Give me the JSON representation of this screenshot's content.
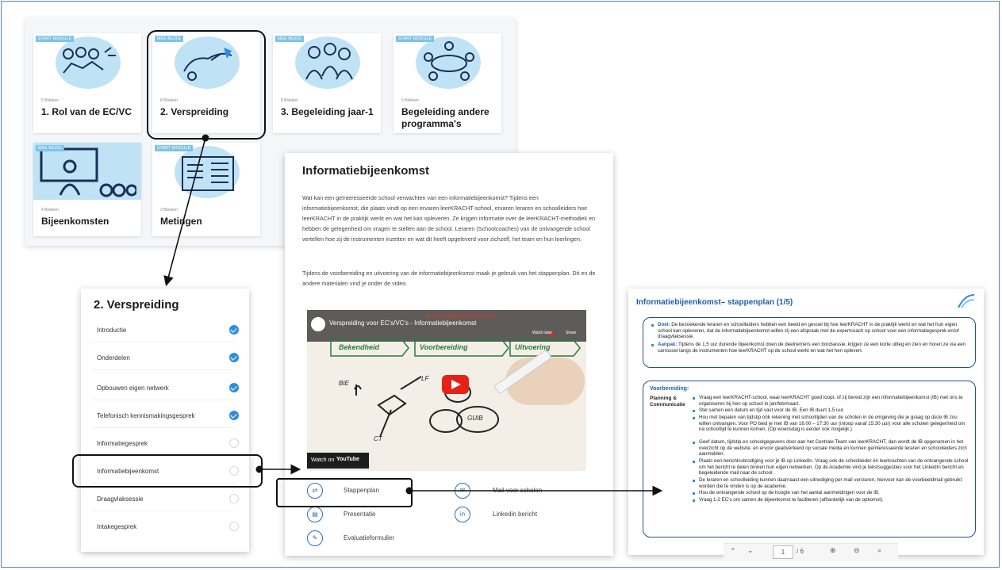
{
  "modules": {
    "cards": [
      {
        "badge": "START MODULE",
        "count": "5 Blokken",
        "title": "1. Rol van de EC/VC"
      },
      {
        "badge": "MEE BEZIG",
        "count": "8 Blokken",
        "title": "2. Verspreiding"
      },
      {
        "badge": "MEE BEZIG",
        "count": "8 Blokken",
        "title": "3. Begeleiding jaar-1"
      },
      {
        "badge": "START MODULE",
        "count": "6 Blokken",
        "title": "Begeleiding andere programma's"
      },
      {
        "badge": "MEE BEZIG",
        "count": "4 Blokken",
        "title": "Bijeenkomsten"
      },
      {
        "badge": "START MODULE",
        "count": "3 Blokken",
        "title": "Metingen"
      }
    ]
  },
  "sidebar": {
    "title": "2. Verspreiding",
    "items": [
      {
        "label": "Introductie",
        "done": true
      },
      {
        "label": "Onderdelen",
        "done": true
      },
      {
        "label": "Opbouwen eigen netwerk",
        "done": true
      },
      {
        "label": "Telefonisch kennismakingsgesprek",
        "done": true
      },
      {
        "label": "Informatiegesprek",
        "done": false
      },
      {
        "label": "Informatiebijeenkomst",
        "done": false
      },
      {
        "label": "Draagvlaksessie",
        "done": false
      },
      {
        "label": "Intakegesprek",
        "done": false
      }
    ]
  },
  "info": {
    "title": "Informatiebijeenkomst",
    "para1": "Wat kan een geïnteresseerde school verwachten van een informatiebijeenkomst? Tijdens een informatiebijeenkomst, die plaats vindt op een ervaren leerKRACHT-school, ervaren leraren en schoolleiders hoe leerKRACHT in de praktijk werkt en wat het kan opleveren. Ze krijgen informatie over de leerKRACHT-methodiek en hebben de gelegenheid om vragen te stellen aan de school. Leraren (Schoolcoaches) van de ontvangende school vertellen hoe zij de instrumenten inzetten en wat dit heeft opgeleverd voor zichzelf, het team en hun leerlingen.",
    "para2": "Tijdens de voorbereiding en uitvoering van de informatiebijeenkomst maak je gebruik van het stappenplan. Dit en de andere materialen vind je onder de video.",
    "video": {
      "title": "Verspreiding voor EC's/VC's - Informatiebijeenkomst",
      "watch_later": "Watch later",
      "share": "Share",
      "watch_on": "Watch on",
      "youtube": "YouTube",
      "board_heading": "Informatiebijeenkomst",
      "board_steps": [
        "Bekendheid",
        "Voorbereiding",
        "Uitvoering"
      ],
      "board_words": [
        "GUIB",
        "LF",
        "BIE",
        "CT"
      ]
    },
    "materials": [
      {
        "label": "Stappenplan",
        "icon": "arrows-icon"
      },
      {
        "label": "Mail voor scholen",
        "icon": "mail-icon"
      },
      {
        "label": "Presentatie",
        "icon": "document-icon"
      },
      {
        "label": "Linkedin bericht",
        "icon": "linkedin-icon"
      },
      {
        "label": "Evaluatieformulier",
        "icon": "pencil-icon"
      }
    ]
  },
  "plan": {
    "title": "Informatiebijeenkomst– stappenplan (1/5)",
    "doel_label": "Doel:",
    "doel_text": "De bezoekende leraren en schoolleiders hebben een beeld en gevoel bij hoe leerKRACHT in de praktijk werkt en wat het hun eigen school kan opleveren, dat de informatiebijeenkomst willen zij een afspraak met de expertcoach op school voor een informatiegesprek en/of draagvlaksessie.",
    "aanpak_label": "Aanpak:",
    "aanpak_text": "Tijdens de 1,5 uur durende bijeenkomst doen de deelnemers een bordsessie, krijgen ze een korte uitleg en zien en horen ze via een carrousel langs de instrumenten hoe leerKRACHT op de school werkt en wat het hen oplevert.",
    "prep_heading": "Voorbereiding:",
    "prep_label": "Planning & Communicatie",
    "bullets": [
      "Vraag een leerKRACHT-school, waar leerKRACHT goed loopt, of zij bereid zijn een informatiebijeenkomst (IB) met ons te organiseren bij hen op school in jan/feb/maart.",
      "Stel samen een datum en tijd vast voor de IB. Een IB duurt 1,5 uur.",
      "Hou met bepalen van tijdstip óók rekening met schooltijden van de scholen in de omgeving die je graag op deze IB zou willen ontvangen. Voor PO bied je met IB van 16:00 – 17:30 uur (inloop vanaf 15:30 uur) voor alle scholen gelegenheid om na schooltijd te kunnen komen. (Op woensdag is eerder ook mogelijk.)",
      "Geef datum, tijdstip en schoolgegevens door aan het Centrale Team van leerKRACHT, dan wordt de IB opgenomen in het overzicht op de website, en ervoor geadverteerd op sociale media en kunnen geïnteresseerde leraren en schoolleiders zich aanmelden.",
      "Plaats een bericht/uitnodiging voor je IB op LinkedIn. Vraag ook de schoolleider én leerkrachten van de ontvangende school om het bericht te delen binnen hun eigen netwerken. Op de Academie vind je tekstsuggesties voor het LinkedIn bericht en begeleidende mail naar de school.",
      "De leraren en schoolleiding kunnen daarnaast een uitnodiging per mail versturen, hiervoor kan de voorbeeldmail gebruikt worden die te vinden is op de academie.",
      "Hou de ontvangende school op de hoogte van het aantal aanmeldingen voor de IB.",
      "Vraag 1-2 EC's om samen de bijeenkomst te faciliteren (afhankelijk van de opkomst)."
    ],
    "page_current": "1",
    "page_total": "/ 6"
  },
  "colors": {
    "accent": "#2d8de0",
    "card_blob": "#bfe3f5",
    "frame": "#5b80b8"
  }
}
